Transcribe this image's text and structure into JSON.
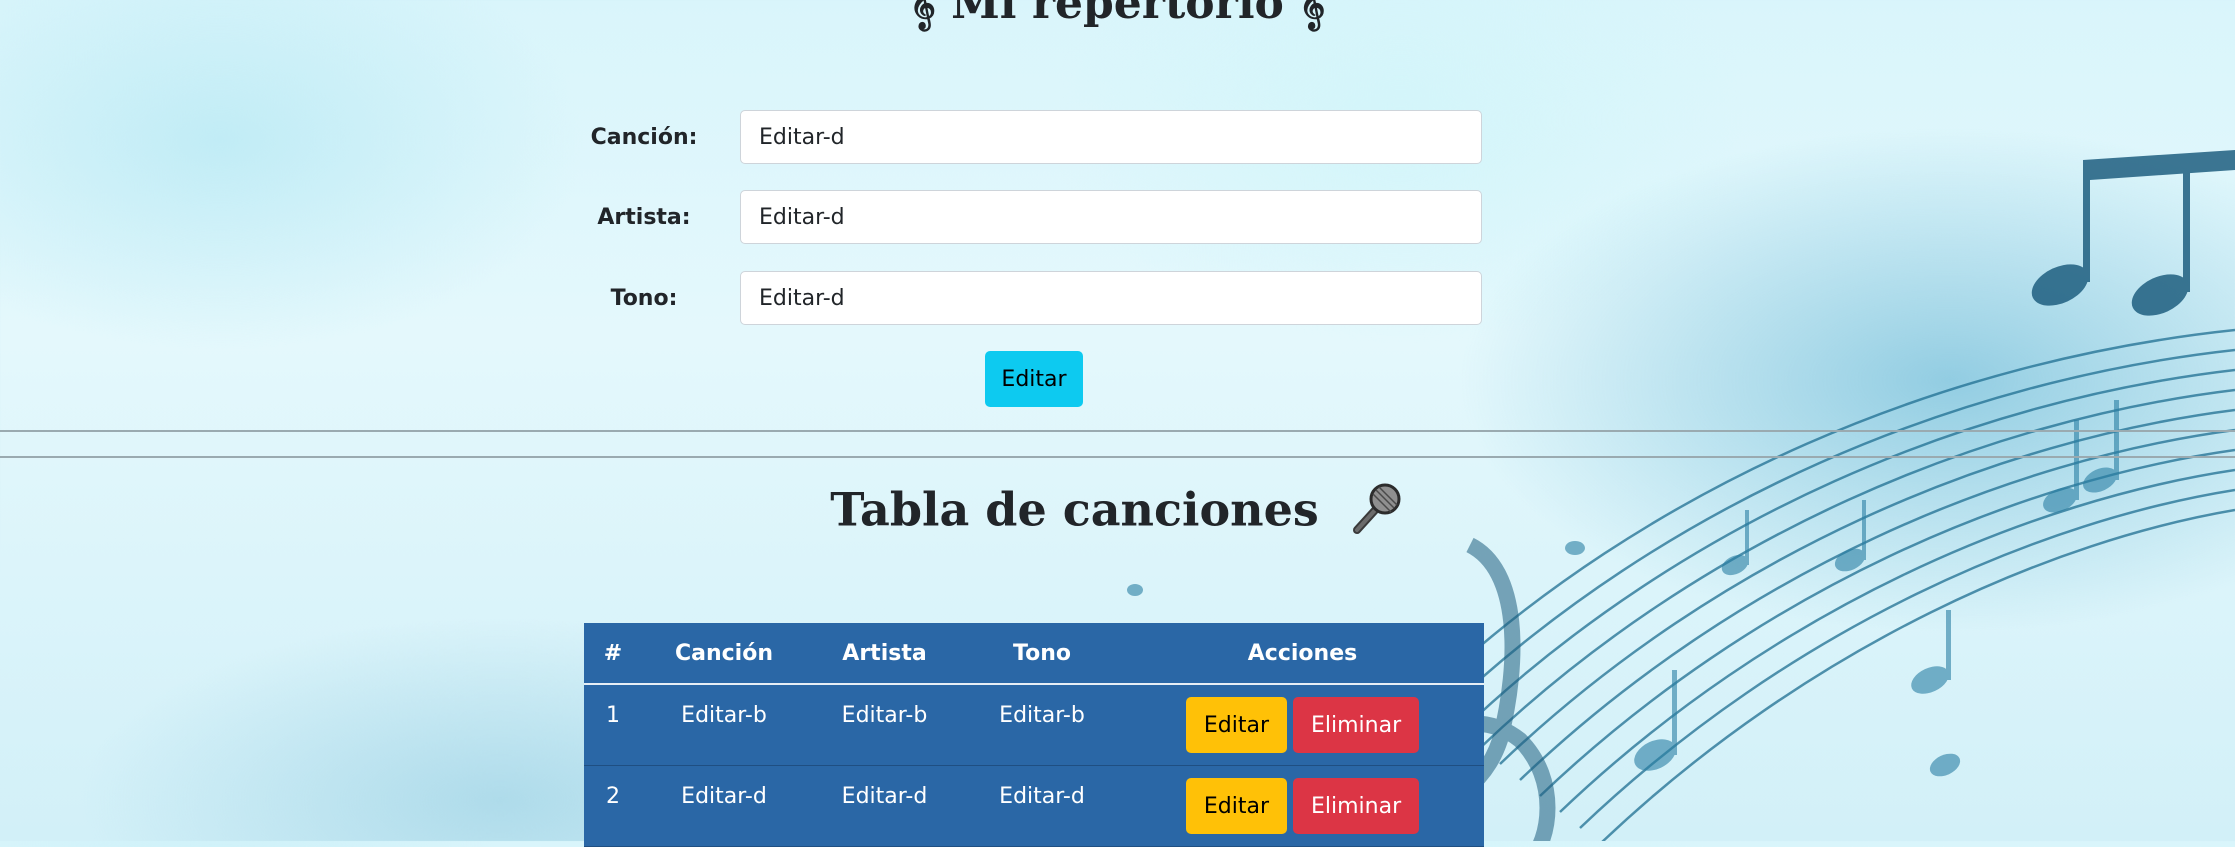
{
  "header": {
    "title": "𝄞 Mi repertorio 𝄞"
  },
  "form": {
    "song_label": "Canción:",
    "song_value": "Editar-d",
    "artist_label": "Artista:",
    "artist_value": "Editar-d",
    "key_label": "Tono:",
    "key_value": "Editar-d",
    "submit_label": "Editar"
  },
  "table_section": {
    "title": "Tabla de canciones",
    "title_icon": "microphone-icon"
  },
  "table": {
    "headers": [
      "#",
      "Canción",
      "Artista",
      "Tono",
      "Acciones"
    ],
    "rows": [
      {
        "num": "1",
        "song": "Editar-b",
        "artist": "Editar-b",
        "key": "Editar-b",
        "edit_label": "Editar",
        "delete_label": "Eliminar"
      },
      {
        "num": "2",
        "song": "Editar-d",
        "artist": "Editar-d",
        "key": "Editar-d",
        "edit_label": "Editar",
        "delete_label": "Eliminar"
      }
    ]
  },
  "colors": {
    "table_bg": "#2a67a6",
    "edit_main_button": "#0dcaf0",
    "edit_row_button": "#ffc107",
    "delete_button": "#dc3545"
  }
}
